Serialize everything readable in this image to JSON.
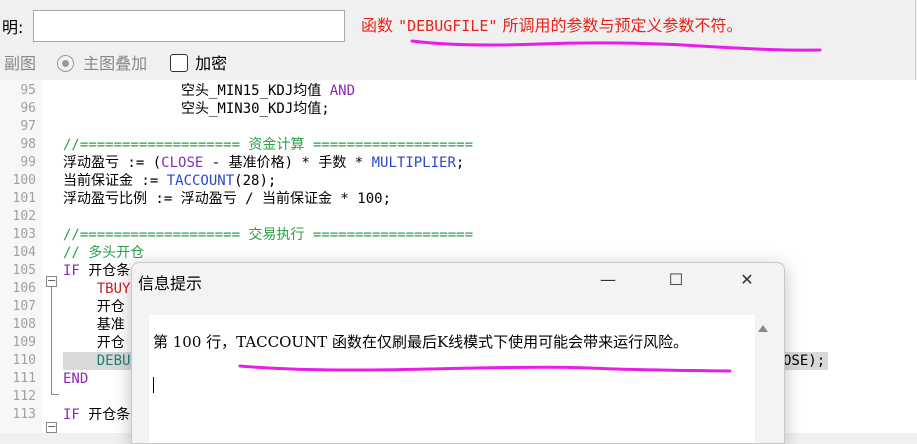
{
  "header": {
    "desc_label": "明:",
    "desc_value": "",
    "error_parts": {
      "prefix": "函数 ",
      "quoted": "\"DEBUGFILE\"",
      "suffix": " 所调用的参数与预定义参数不符。"
    },
    "options": {
      "sub_chart": "副图",
      "main_overlay": "主图叠加",
      "encrypt": "加密"
    }
  },
  "editor": {
    "lines": [
      {
        "num": "95",
        "segments": [
          {
            "t": "              空头_MIN15_KDJ均值 ",
            "c": ""
          },
          {
            "t": "AND",
            "c": "kw"
          }
        ]
      },
      {
        "num": "96",
        "segments": [
          {
            "t": "              空头_MIN30_KDJ均值;",
            "c": ""
          }
        ]
      },
      {
        "num": "97",
        "segments": []
      },
      {
        "num": "98",
        "segments": [
          {
            "t": "//=================== 资金计算 ===================",
            "c": "green"
          }
        ]
      },
      {
        "num": "99",
        "segments": [
          {
            "t": "浮动盈亏 := (",
            "c": ""
          },
          {
            "t": "CLOSE",
            "c": "kw"
          },
          {
            "t": " - 基准价格) * 手数 * ",
            "c": ""
          },
          {
            "t": "MULTIPLIER",
            "c": "blue"
          },
          {
            "t": ";",
            "c": ""
          }
        ]
      },
      {
        "num": "100",
        "segments": [
          {
            "t": "当前保证金 := ",
            "c": ""
          },
          {
            "t": "TACCOUNT",
            "c": "blue"
          },
          {
            "t": "(28);",
            "c": ""
          }
        ]
      },
      {
        "num": "101",
        "segments": [
          {
            "t": "浮动盈亏比例 := 浮动盈亏 / 当前保证金 * 100;",
            "c": ""
          }
        ]
      },
      {
        "num": "102",
        "segments": []
      },
      {
        "num": "103",
        "segments": [
          {
            "t": "//=================== 交易执行 ===================",
            "c": "green"
          }
        ]
      },
      {
        "num": "104",
        "segments": [
          {
            "t": "// 多头开仓",
            "c": "green"
          }
        ]
      },
      {
        "num": "105",
        "segments": [
          {
            "t": "IF",
            "c": "kw"
          },
          {
            "t": " 开仓条",
            "c": ""
          }
        ]
      },
      {
        "num": "106",
        "segments": [
          {
            "t": "    TBUY",
            "c": "red"
          }
        ]
      },
      {
        "num": "107",
        "segments": [
          {
            "t": "    开仓",
            "c": ""
          }
        ]
      },
      {
        "num": "108",
        "segments": [
          {
            "t": "    基准",
            "c": ""
          }
        ]
      },
      {
        "num": "109",
        "segments": [
          {
            "t": "    开仓",
            "c": ""
          }
        ]
      },
      {
        "num": "110",
        "segments": [
          {
            "t": "    DEBU",
            "c": "teal"
          }
        ]
      },
      {
        "num": "111",
        "segments": [
          {
            "t": "END",
            "c": "kw"
          }
        ]
      },
      {
        "num": "112",
        "segments": []
      },
      {
        "num": "113",
        "segments": [
          {
            "t": "IF",
            "c": "kw"
          },
          {
            "t": " 开仓条",
            "c": ""
          }
        ]
      }
    ],
    "line110_tail": "OSE);"
  },
  "dialog": {
    "title": "信息提示",
    "minimize": "—",
    "maximize": "☐",
    "close": "✕",
    "message": "第 100 行，TACCOUNT 函数在仅刷最后K线模式下使用可能会带来运行风险。"
  },
  "colors": {
    "error_text": "#e8231b",
    "annotation": "#e81ee8",
    "keyword": "#8a2ab8",
    "function": "#2a49c7",
    "comment": "#2aa14a"
  }
}
